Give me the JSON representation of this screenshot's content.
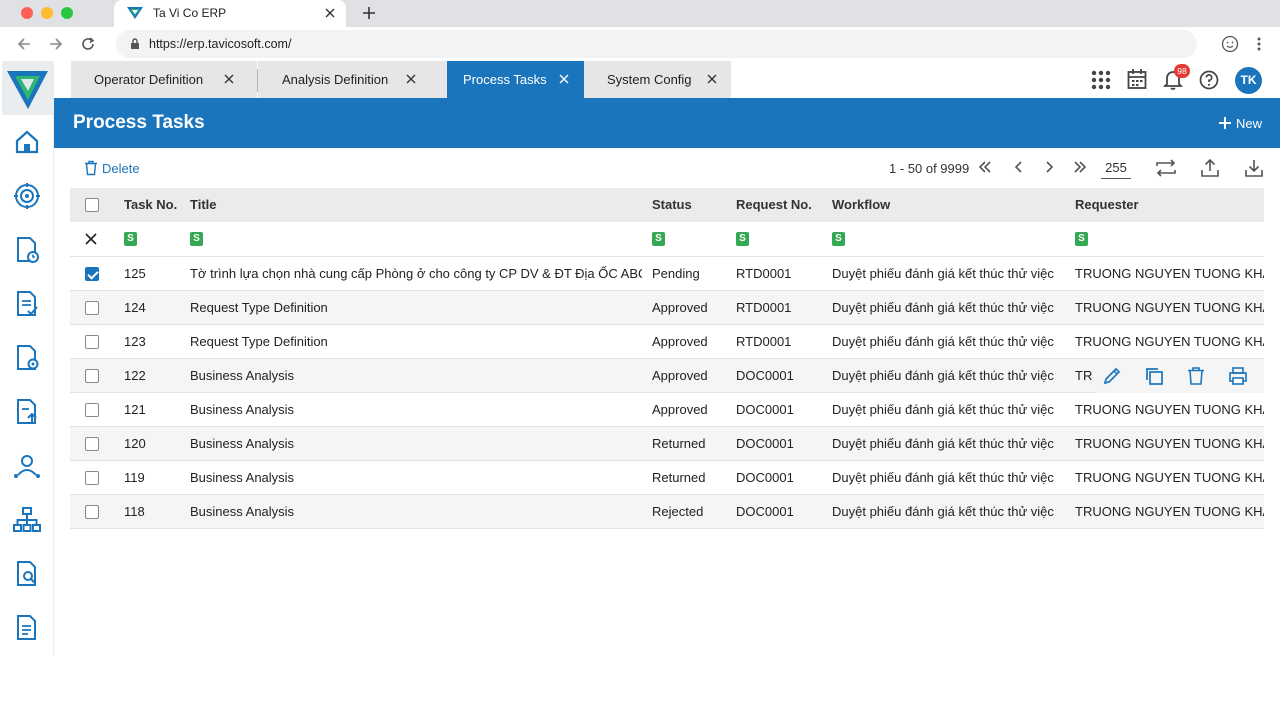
{
  "browser": {
    "tab_title": "Ta Vi Co ERP",
    "url": "https://erp.tavicosoft.com/"
  },
  "app_tabs": [
    {
      "label": "Operator Definition",
      "active": false
    },
    {
      "label": "Analysis Definition",
      "active": false
    },
    {
      "label": "Process Tasks",
      "active": true
    },
    {
      "label": "System Config",
      "active": false
    }
  ],
  "header": {
    "title": "Process Tasks",
    "new_label": "New",
    "notification_count": "98",
    "avatar_initials": "TK"
  },
  "sidebar": {
    "icons": [
      "home-icon",
      "settings-cycle-icon",
      "document-clock-icon",
      "document-check-icon",
      "document-gear-icon",
      "document-upload-icon",
      "user-network-icon",
      "org-chart-icon",
      "document-search-icon",
      "document-text-icon"
    ]
  },
  "toolbar": {
    "delete_label": "Delete",
    "page_range": "1 - 50 of 9999",
    "page_size": "255"
  },
  "grid": {
    "columns": [
      "Task No.",
      "Title",
      "Status",
      "Request No.",
      "Workflow",
      "Requester"
    ],
    "filter_badge": "S",
    "rows": [
      {
        "task_no": "125",
        "title": "Tờ trình lựa chọn nhà cung cấp Phòng ở cho công ty CP DV & ĐT Địa ỐC ABC",
        "status": "Pending",
        "request_no": "RTD0001",
        "workflow": "Duyệt phiếu đánh giá kết thúc thử việc",
        "requester": "TRUONG NGUYEN TUONG KHANH",
        "checked": true
      },
      {
        "task_no": "124",
        "title": "Request Type Definition",
        "status": "Approved",
        "request_no": "RTD0001",
        "workflow": "Duyệt phiếu đánh giá kết thúc thử việc",
        "requester": "TRUONG NGUYEN TUONG KHANH",
        "checked": false
      },
      {
        "task_no": "123",
        "title": "Request Type Definition",
        "status": "Approved",
        "request_no": "RTD0001",
        "workflow": "Duyệt phiếu đánh giá kết thúc thử việc",
        "requester": "TRUONG NGUYEN TUONG KHANH",
        "checked": false
      },
      {
        "task_no": "122",
        "title": "Business Analysis",
        "status": "Approved",
        "request_no": "DOC0001",
        "workflow": "Duyệt phiếu đánh giá kết thúc thử việc",
        "requester": "TR",
        "checked": false
      },
      {
        "task_no": "121",
        "title": "Business Analysis",
        "status": "Approved",
        "request_no": "DOC0001",
        "workflow": "Duyệt phiếu đánh giá kết thúc thử việc",
        "requester": "TRUONG NGUYEN TUONG KHANH",
        "checked": false
      },
      {
        "task_no": "120",
        "title": "Business Analysis",
        "status": "Returned",
        "request_no": "DOC0001",
        "workflow": "Duyệt phiếu đánh giá kết thúc thử việc",
        "requester": "TRUONG NGUYEN TUONG KHANH",
        "checked": false
      },
      {
        "task_no": "119",
        "title": "Business Analysis",
        "status": "Returned",
        "request_no": "DOC0001",
        "workflow": "Duyệt phiếu đánh giá kết thúc thử việc",
        "requester": "TRUONG NGUYEN TUONG KHANH",
        "checked": false
      },
      {
        "task_no": "118",
        "title": "Business Analysis",
        "status": "Rejected",
        "request_no": "DOC0001",
        "workflow": "Duyệt phiếu đánh giá kết thúc thử việc",
        "requester": "TRUONG NGUYEN TUONG KHANH",
        "checked": false
      }
    ]
  },
  "colors": {
    "primary": "#1a75bc",
    "filter_badge": "#34a853",
    "notification_badge": "#e53935"
  }
}
